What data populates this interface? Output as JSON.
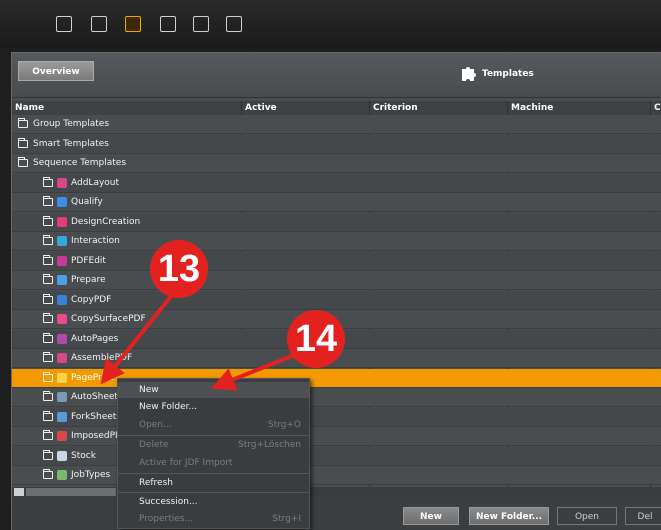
{
  "toolbar": {
    "icons": [
      "jdf-icon",
      "layout-icon",
      "templates-icon",
      "hierarchy-icon",
      "pdf-icon",
      "job-list-icon"
    ],
    "active_icon": "templates-icon",
    "accent": "#f0a400"
  },
  "header": {
    "overview_label": "Overview",
    "title": "Templates"
  },
  "columns": [
    "Name",
    "Active",
    "Criterion",
    "Machine",
    "C"
  ],
  "rows": [
    {
      "label": "Group Templates",
      "indent": 0
    },
    {
      "label": "Smart Templates",
      "indent": 0
    },
    {
      "label": "Sequence Templates",
      "indent": 0,
      "open": true
    },
    {
      "label": "AddLayout",
      "indent": 1,
      "color": "#d9468a"
    },
    {
      "label": "Qualify",
      "indent": 1,
      "color": "#3a8ee6"
    },
    {
      "label": "DesignCreation",
      "indent": 1,
      "color": "#e63b7a"
    },
    {
      "label": "Interaction",
      "indent": 1,
      "color": "#37a6e0"
    },
    {
      "label": "PDFEdit",
      "indent": 1,
      "color": "#c83898"
    },
    {
      "label": "Prepare",
      "indent": 1,
      "color": "#4aa3e8"
    },
    {
      "label": "CopyPDF",
      "indent": 1,
      "color": "#3c7fd8"
    },
    {
      "label": "CopySurfacePDF",
      "indent": 1,
      "color": "#e84a8a"
    },
    {
      "label": "AutoPages",
      "indent": 1,
      "color": "#b04aa8"
    },
    {
      "label": "AssemblePDF",
      "indent": 1,
      "color": "#d8468a"
    },
    {
      "label": "PagePrint",
      "indent": 1,
      "color": "#f7d34a",
      "selected": true
    },
    {
      "label": "AutoSheets",
      "indent": 1,
      "color": "#7a9ab8"
    },
    {
      "label": "ForkSheets",
      "indent": 1,
      "color": "#5a9ad8"
    },
    {
      "label": "ImposedPDF",
      "indent": 1,
      "color": "#d84848"
    },
    {
      "label": "Stock",
      "indent": 1,
      "color": "#c8d8e8"
    },
    {
      "label": "JobTypes",
      "indent": 1,
      "color": "#7ab86a"
    }
  ],
  "context_menu": [
    {
      "label": "New",
      "enabled": true
    },
    {
      "label": "New Folder...",
      "enabled": true
    },
    {
      "label": "Open...",
      "enabled": false,
      "shortcut": "Strg+O"
    },
    {
      "label": "Delete",
      "enabled": false,
      "shortcut": "Strg+Löschen"
    },
    {
      "label": "Active for JDF Import",
      "enabled": false
    },
    {
      "label": "Refresh",
      "enabled": true
    },
    {
      "label": "Succession...",
      "enabled": true
    },
    {
      "label": "Properties...",
      "enabled": false,
      "shortcut": "Strg+I"
    }
  ],
  "footer": {
    "new_label": "New",
    "new_folder_label": "New Folder...",
    "open_label": "Open",
    "delete_label": "Del"
  },
  "callouts": {
    "a": "13",
    "b": "14"
  }
}
